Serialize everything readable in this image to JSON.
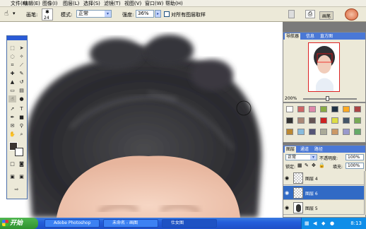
{
  "menubar": {
    "items": [
      "文件(F)",
      "编辑(E)",
      "图像(I)",
      "图层(L)",
      "选择(S)",
      "滤镜(T)",
      "视图(V)",
      "窗口(W)",
      "帮助(H)"
    ]
  },
  "options": {
    "brush_label": "画笔:",
    "brush_size": "24",
    "mode_label": "模式:",
    "mode_value": "正常",
    "strength_label": "强度:",
    "strength_value": "36%",
    "sample_all_label": "对所有图层取样",
    "right_button": "画笔"
  },
  "navigator": {
    "tabs": [
      "导航器",
      "信息",
      "直方图"
    ],
    "zoom_value": "200%"
  },
  "layers": {
    "tabs": [
      "图层",
      "通道",
      "路径"
    ],
    "blend_mode": "正常",
    "opacity_label": "不透明度:",
    "opacity_value": "100%",
    "lock_label": "锁定:",
    "fill_label": "填充:",
    "fill_value": "100%",
    "rows": [
      {
        "name": "图层 4",
        "selected": false
      },
      {
        "name": "图层 6",
        "selected": true
      },
      {
        "name": "图层 5",
        "selected": false
      }
    ]
  },
  "taskbar": {
    "start_label": "开始",
    "tasks": [
      "Adobe Photoshop",
      "未命名 - 画图",
      "仕女图"
    ],
    "clock": "8:13"
  },
  "colors": {
    "accent": "#316ac5",
    "title_blue": "#4a78d6",
    "foreground_color": "#3a3430",
    "background_color": "#ffffff"
  },
  "icons": [
    "smudge-tool-icon",
    "brush-preset-icon",
    "eye-icon",
    "lock-icon",
    "start-icon"
  ]
}
